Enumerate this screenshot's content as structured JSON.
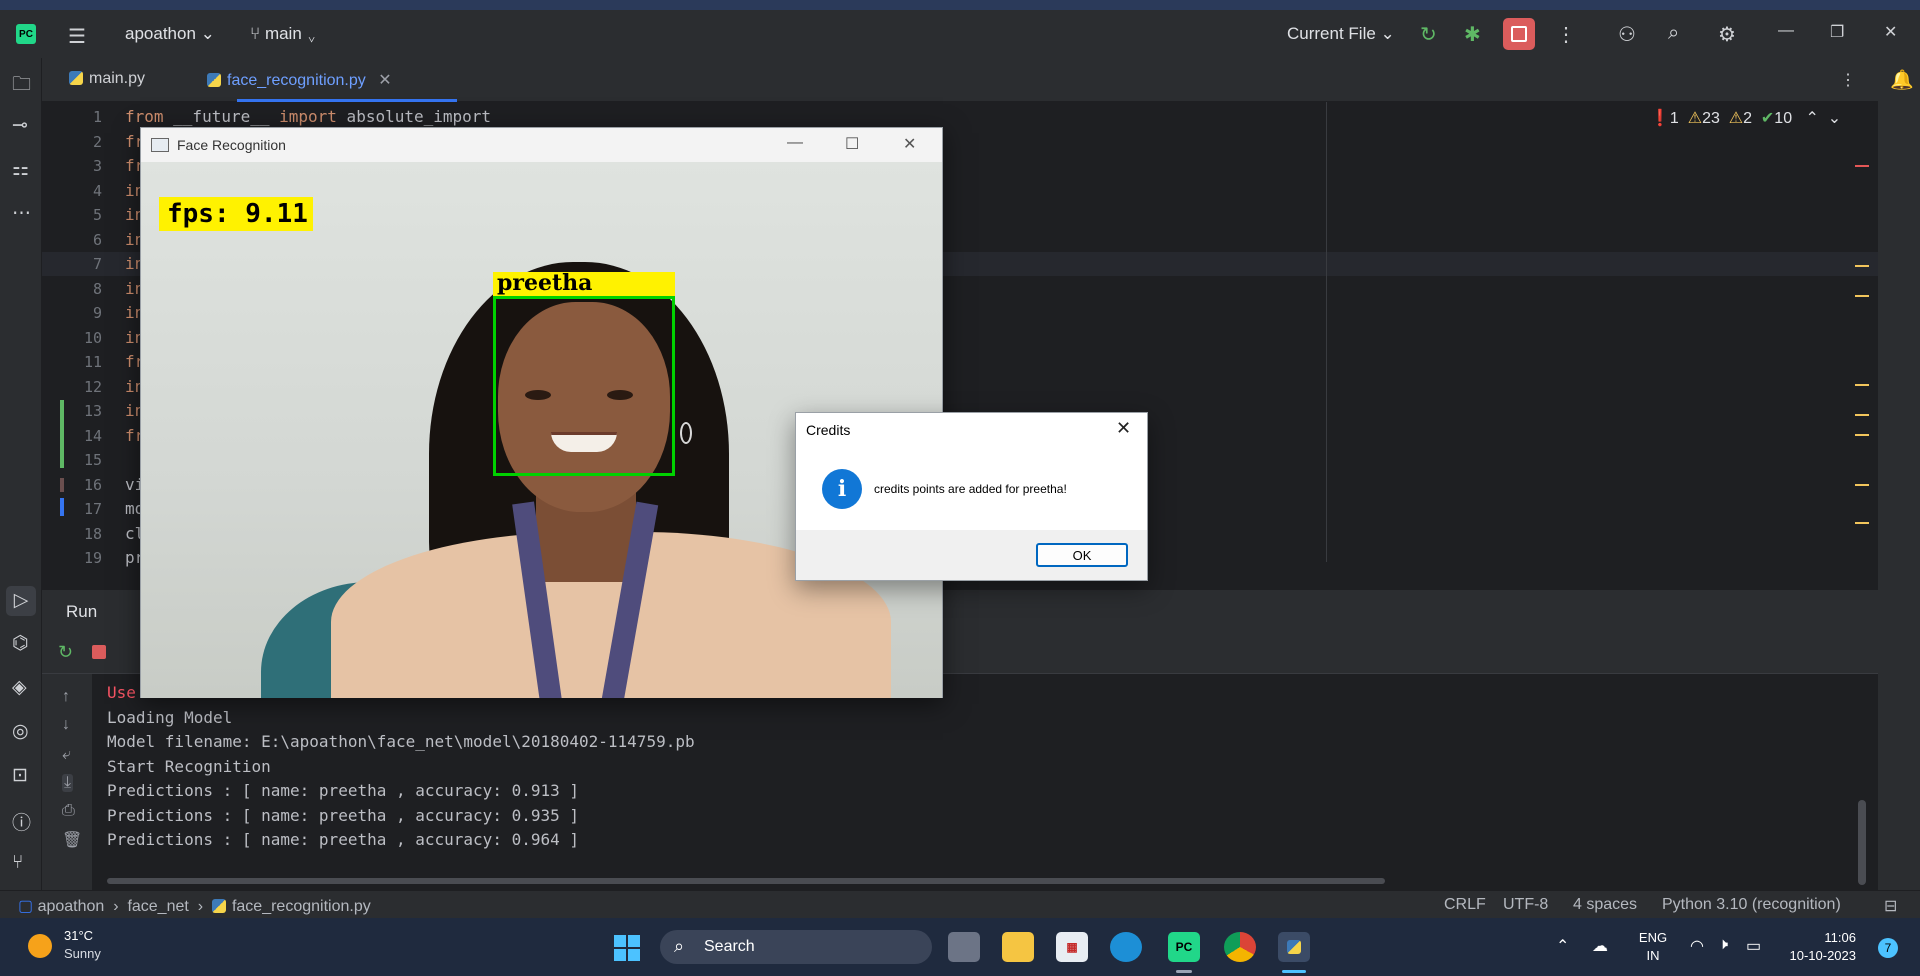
{
  "ide": {
    "logo": "PC",
    "project": "apoathon",
    "branch": "main",
    "run_config": "Current File",
    "tabs": [
      {
        "label": "main.py"
      },
      {
        "label": "face_recognition.py"
      }
    ],
    "inspections": {
      "errors": "1",
      "warnings": "23",
      "weak_warnings": "2",
      "ok": "10"
    },
    "code": [
      {
        "num": "1",
        "kw": "from",
        "rest": " __future__ ",
        "kw2": "import",
        "rest2": " absolute_import"
      },
      {
        "num": "2",
        "kw": "fr"
      },
      {
        "num": "3",
        "kw": "fr"
      },
      {
        "num": "4",
        "kw": "in"
      },
      {
        "num": "5",
        "kw": "in"
      },
      {
        "num": "6",
        "kw": "in"
      },
      {
        "num": "7",
        "kw": "in"
      },
      {
        "num": "8",
        "kw": "in"
      },
      {
        "num": "9",
        "kw": "in"
      },
      {
        "num": "10",
        "kw": "in"
      },
      {
        "num": "11",
        "kw": "fr"
      },
      {
        "num": "12",
        "kw": "in"
      },
      {
        "num": "13",
        "kw": "in"
      },
      {
        "num": "14",
        "kw": "fr"
      },
      {
        "num": "15",
        "kw": ""
      },
      {
        "num": "16",
        "plain": "vi"
      },
      {
        "num": "17",
        "plain": "mo"
      },
      {
        "num": "18",
        "plain": "cl"
      },
      {
        "num": "19",
        "plain": "pr"
      }
    ],
    "run": {
      "title": "Run",
      "console": [
        {
          "text": "Use",
          "style": "red"
        },
        {
          "text": "Loading Model"
        },
        {
          "text": "Model filename: E:\\apoathon\\face_net\\model\\20180402-114759.pb"
        },
        {
          "text": "Start Recognition"
        },
        {
          "text": "Predictions : [ name: preetha , accuracy: 0.913 ]"
        },
        {
          "text": "Predictions : [ name: preetha , accuracy: 0.935 ]"
        },
        {
          "text": "Predictions : [ name: preetha , accuracy: 0.964 ]"
        }
      ]
    },
    "statusbar": {
      "breadcrumb": [
        "apoathon",
        "face_net",
        "face_recognition.py"
      ],
      "line_sep": "CRLF",
      "encoding": "UTF-8",
      "indent": "4 spaces",
      "interpreter": "Python 3.10 (recognition)"
    }
  },
  "face_window": {
    "title": "Face Recognition",
    "fps": "fps: 9.11",
    "name_label": "preetha"
  },
  "dialog": {
    "title": "Credits",
    "message": "credits points are added for preetha!",
    "ok": "OK",
    "info_glyph": "i"
  },
  "taskbar": {
    "temp": "31°C",
    "condition": "Sunny",
    "search": "Search",
    "pycharm": "PC",
    "lang1": "ENG",
    "lang2": "IN",
    "time": "11:06",
    "date": "10-10-2023",
    "notif": "7"
  },
  "colors": {
    "accent": "#3574f0",
    "stop": "#db5c5c",
    "face_box": "#00d200",
    "label_bg": "#fff200"
  }
}
